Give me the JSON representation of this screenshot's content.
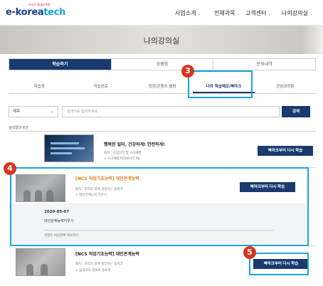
{
  "header": {
    "logo_part1": "e-korea",
    "logo_part2": "tech",
    "logo_tag": "온라인 평생교육원",
    "nav": [
      {
        "label": "사업소개",
        "chevron": "⌄"
      },
      {
        "label": "전체과목",
        "chevron": "⌄"
      },
      {
        "label": "고객센터",
        "chevron": "⌄"
      },
      {
        "label": "나의강의실",
        "chevron": "⌄"
      }
    ]
  },
  "banner": {
    "title": "나의강의실"
  },
  "top_tabs": [
    "학습하기",
    "상품함",
    "문의내역"
  ],
  "sub_tabs": [
    "학습중",
    "학습완료",
    "정정/콘텐츠 별람",
    "나의 학습메모/북마크",
    "관심과정함"
  ],
  "search": {
    "select_value": "제목",
    "select_chevron": "⌄",
    "placeholder": "검색어를 입력하세요",
    "button_label": "검색"
  },
  "result_count": "검색결과 6건",
  "courses": [
    {
      "title": "행복한 일터, 건강하게! 안전하게!",
      "meta1": "회차 : 산업안전 및 사고예방",
      "meta2": "> 사고예방처리00:07:58",
      "button": "북마크부터 다시 학습"
    },
    {
      "title": "[NCS 직업기초능력] 대인관계능력",
      "meta1": "회차 : 조직과 함께 성장하는 팀워크",
      "meta2": "> 대인관계능력 키우기",
      "button": "북마크부터 다시 학습"
    },
    {
      "title": "[NCS 직업기초능력] 대인관계능력",
      "meta1": "회차 : 조직과 함께 성장하는 팀워크",
      "meta2": "> 팀워크의 정의와 중요성",
      "button": "북마크부터 다시 학습"
    }
  ],
  "memo": {
    "date": "2020-05-07",
    "text": "대인관계능력키우기",
    "hint": "검정은 비공란에 해소하기"
  },
  "callouts": [
    "3",
    "4",
    "5"
  ],
  "colors": {
    "navy": "#183a6e",
    "highlight": "#19a4dd",
    "badge": "#d8331d",
    "accent_title": "#e07c1b"
  }
}
